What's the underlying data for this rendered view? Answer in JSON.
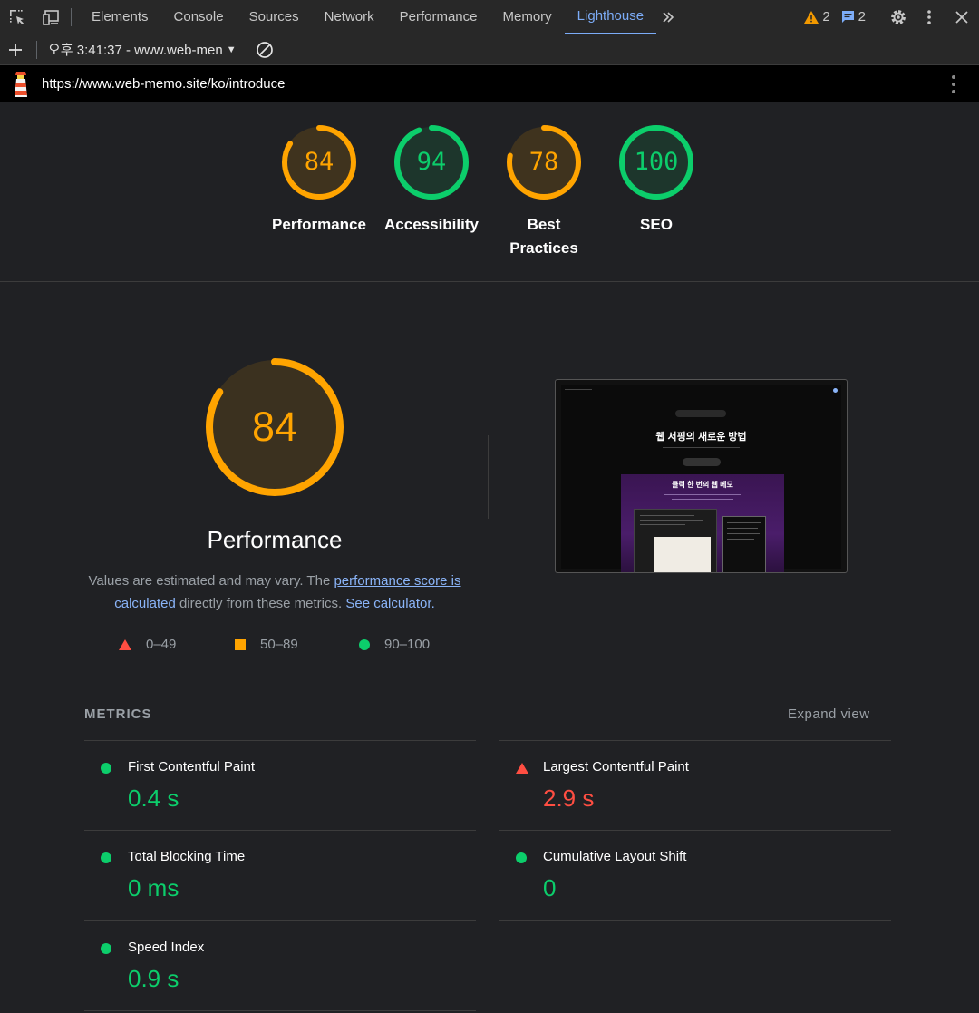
{
  "devtools": {
    "tabs": [
      "Elements",
      "Console",
      "Sources",
      "Network",
      "Performance",
      "Memory",
      "Lighthouse"
    ],
    "active_tab": "Lighthouse",
    "warnings_count": "2",
    "messages_count": "2"
  },
  "toolbar": {
    "report_label": "오후 3:41:37 - www.web-men"
  },
  "url": "https://www.web-memo.site/ko/introduce",
  "gauges": [
    {
      "label": "Performance",
      "score": "84",
      "color": "#ffa400"
    },
    {
      "label": "Accessibility",
      "score": "94",
      "color": "#0cce6b"
    },
    {
      "label": "Best Practices",
      "score": "78",
      "color": "#ffa400"
    },
    {
      "label": "SEO",
      "score": "100",
      "color": "#0cce6b"
    }
  ],
  "performance": {
    "score": "84",
    "title": "Performance",
    "desc_prefix": "Values are estimated and may vary. The ",
    "desc_link1": "performance score is calculated",
    "desc_mid": " directly from these metrics. ",
    "desc_link2": "See calculator."
  },
  "legend": {
    "fail": "0–49",
    "average": "50–89",
    "pass": "90–100"
  },
  "screenshot": {
    "title": "웹 서핑의 새로운 방법",
    "panel_title": "클릭 한 번의 웹 메모"
  },
  "metrics": {
    "heading": "METRICS",
    "expand_label": "Expand view",
    "items": [
      {
        "label": "First Contentful Paint",
        "value": "0.4 s",
        "status": "pass"
      },
      {
        "label": "Largest Contentful Paint",
        "value": "2.9 s",
        "status": "fail"
      },
      {
        "label": "Total Blocking Time",
        "value": "0 ms",
        "status": "pass"
      },
      {
        "label": "Cumulative Layout Shift",
        "value": "0",
        "status": "pass"
      },
      {
        "label": "Speed Index",
        "value": "0.9 s",
        "status": "pass"
      }
    ]
  },
  "colors": {
    "pass": "#0cce6b",
    "average": "#ffa400",
    "fail": "#ff4e42",
    "accent": "#7cacf8"
  }
}
